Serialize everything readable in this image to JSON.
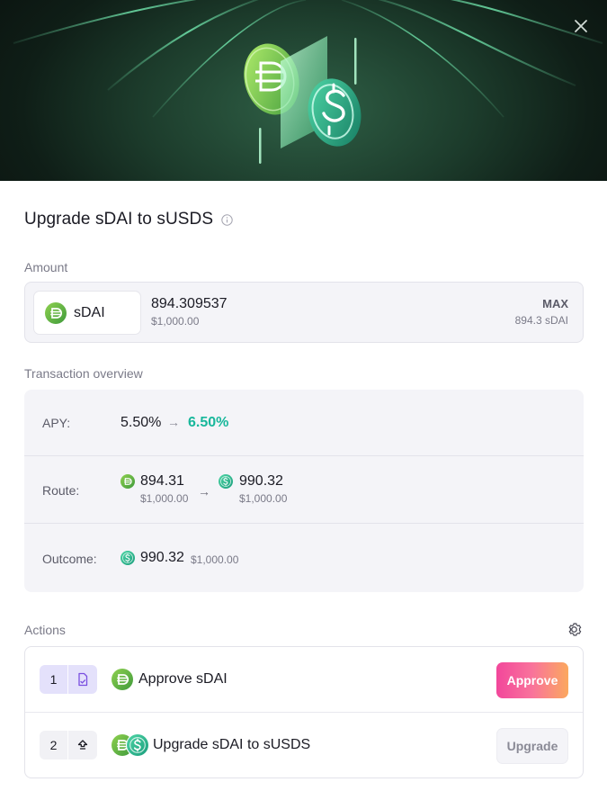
{
  "dialog": {
    "title": "Upgrade sDAI to sUSDS"
  },
  "amount": {
    "label": "Amount",
    "token": "sDAI",
    "value": "894.309537",
    "usd": "$1,000.00",
    "max_label": "MAX",
    "balance": "894.3 sDAI"
  },
  "overview": {
    "label": "Transaction overview",
    "apy": {
      "label": "APY:",
      "from": "5.50%",
      "arrow": "→",
      "to": "6.50%"
    },
    "route": {
      "label": "Route:",
      "from_value": "894.31",
      "from_usd": "$1,000.00",
      "arrow": "→",
      "to_value": "990.32",
      "to_usd": "$1,000.00"
    },
    "outcome": {
      "label": "Outcome:",
      "value": "990.32",
      "usd": "$1,000.00"
    }
  },
  "actions": {
    "label": "Actions",
    "items": [
      {
        "step": "1",
        "label": "Approve sDAI",
        "button": "Approve",
        "icon": "document-sign-icon"
      },
      {
        "step": "2",
        "label": "Upgrade sDAI to sUSDS",
        "button": "Upgrade",
        "icon": "upgrade-arrow-icon"
      }
    ]
  },
  "colors": {
    "sdai_green": "#5fb043",
    "susds_teal": "#23b48f",
    "apy_positive": "#18b79b",
    "approve_gradient": [
      "#f2479b",
      "#fba85e"
    ],
    "step_active_bg": "#e4e1fb"
  }
}
